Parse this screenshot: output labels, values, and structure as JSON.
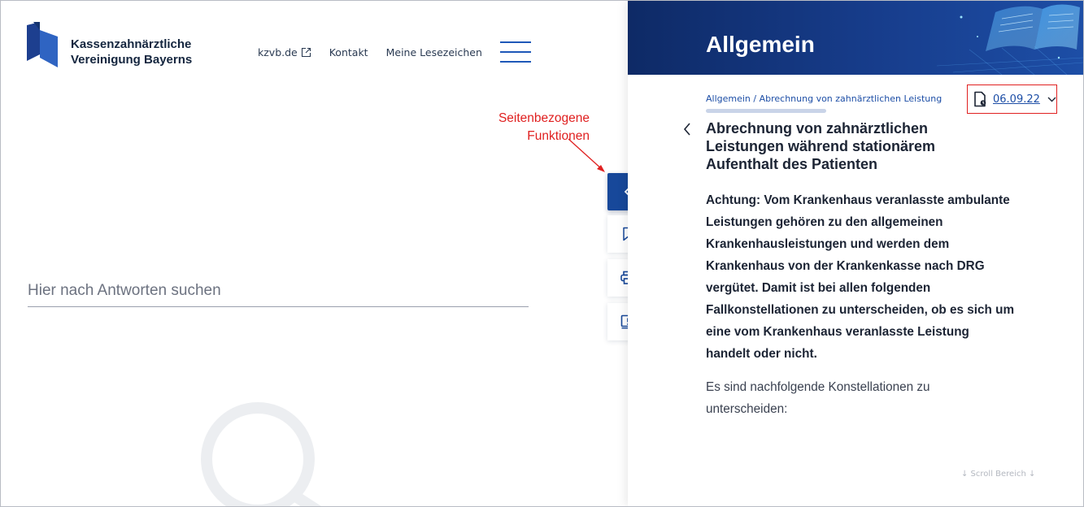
{
  "org": {
    "line1": "Kassenzahnärztliche",
    "line2": "Vereinigung Bayerns"
  },
  "nav": {
    "site_link": "kzvb.de",
    "contact": "Kontakt",
    "bookmarks": "Meine Lesezeichen"
  },
  "search": {
    "placeholder": "Hier nach Antworten suchen"
  },
  "annotation": {
    "line1": "Seitenbezogene",
    "line2": "Funktionen"
  },
  "panel": {
    "header_title": "Allgemein",
    "breadcrumb": "Allgemein / Abrechnung von zahnärztlichen Leistung",
    "date": "06.09.22",
    "title_lines": [
      "Abrechnung von zahnärztlichen",
      "Leistungen während stationärem",
      "Aufenthalt des Patienten"
    ],
    "bold_lines": [
      "Achtung: Vom Krankenhaus veranlasste ambulante",
      "Leistungen gehören zu den allgemeinen",
      "Krankenhausleistungen und werden dem",
      "Krankenhaus von der Krankenkasse nach DRG",
      "vergütet. Damit ist bei allen folgenden",
      "Fallkonstellationen zu unterscheiden, ob es sich um",
      "eine vom Krankenhaus veranlasste Leistung",
      "handelt oder nicht."
    ],
    "normal_lines": [
      "Es sind nachfolgende Konstellationen zu",
      "unterscheiden:"
    ],
    "scroll_hint": "↓   Scroll Bereich   ↓"
  },
  "icons": {
    "toolbar": [
      "chevron-left-icon",
      "bookmark-icon",
      "printer-icon",
      "report-icon"
    ],
    "header": [
      "external-link-icon",
      "hamburger-menu-icon"
    ],
    "panel": [
      "document-version-icon",
      "chevron-down-icon",
      "back-chevron-icon"
    ]
  },
  "colors": {
    "brand_blue": "#17489a",
    "annotation_red": "#e02020",
    "link_blue": "#1d4ea6"
  }
}
